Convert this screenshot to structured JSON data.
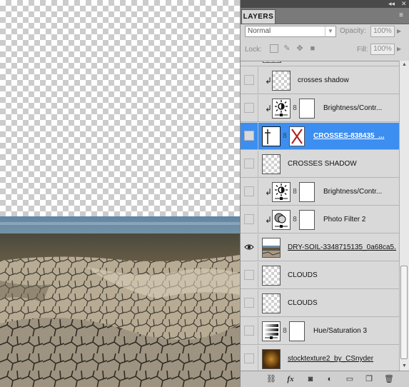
{
  "panel": {
    "tab_label": "LAYERS",
    "collapse_glyph": "◂◂",
    "close_glyph": "✕",
    "menu_glyph": "≡",
    "blend_mode": "Normal",
    "opacity_label": "Opacity:",
    "opacity_value": "100%",
    "lock_label": "Lock:",
    "fill_label": "Fill:",
    "fill_value": "100%"
  },
  "layers": [
    {
      "name": "crosses shadow",
      "type": "pixel",
      "clipped": true,
      "visible": false,
      "selected": false
    },
    {
      "name": "Brightness/Contr...",
      "type": "adjustment-brightness",
      "clipped": true,
      "visible": false,
      "selected": false
    },
    {
      "name": "CROSSES-838435_...",
      "type": "smart-crosses",
      "clipped": false,
      "visible": false,
      "selected": true
    },
    {
      "name": "CROSSES SHADOW",
      "type": "pixel",
      "clipped": false,
      "visible": false,
      "selected": false
    },
    {
      "name": "Brightness/Contr...",
      "type": "adjustment-brightness",
      "clipped": true,
      "visible": false,
      "selected": false
    },
    {
      "name": "Photo Filter 2",
      "type": "adjustment-photofilter",
      "clipped": true,
      "visible": false,
      "selected": false
    },
    {
      "name": "DRY-SOIL-3348715135_0a68ca5...",
      "type": "image-soil",
      "clipped": false,
      "visible": true,
      "selected": false
    },
    {
      "name": "CLOUDS",
      "type": "pixel",
      "clipped": false,
      "visible": false,
      "selected": false
    },
    {
      "name": "CLOUDS",
      "type": "pixel",
      "clipped": false,
      "visible": false,
      "selected": false
    },
    {
      "name": "Hue/Saturation 3",
      "type": "adjustment-huesat",
      "clipped": false,
      "visible": false,
      "selected": false
    },
    {
      "name": "stocktexture2_by_CSnyder",
      "type": "image-texture",
      "clipped": false,
      "visible": false,
      "selected": false
    }
  ],
  "bottom_icons": [
    "link-layers-icon",
    "fx-icon",
    "add-mask-icon",
    "new-adjustment-icon",
    "new-group-icon",
    "new-layer-icon",
    "trash-icon"
  ],
  "colors": {
    "selection": "#3c8ef0",
    "panel": "#d6d6d6"
  }
}
